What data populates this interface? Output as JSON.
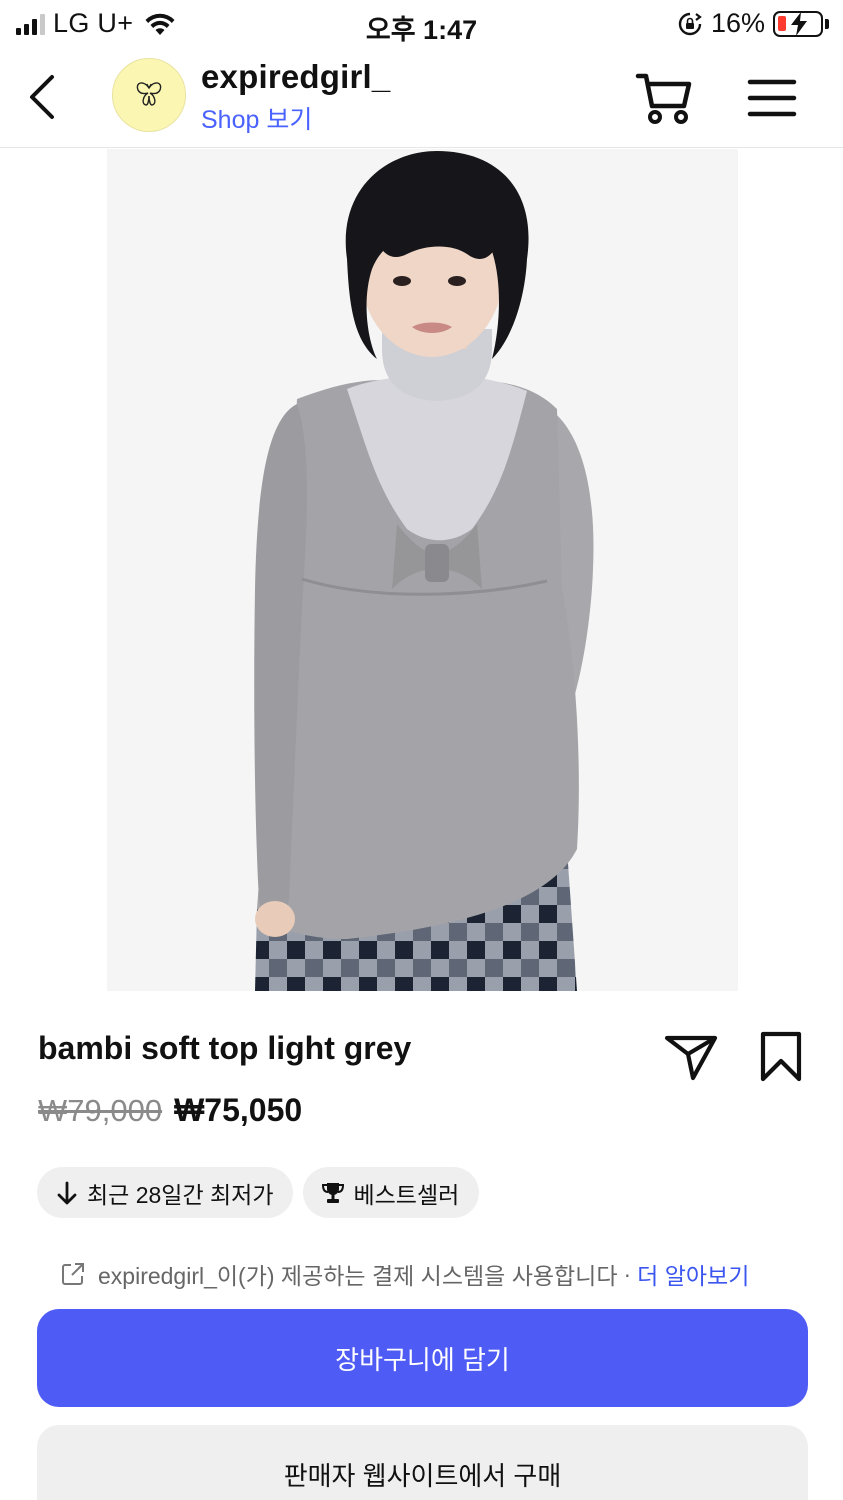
{
  "status_bar": {
    "carrier": "LG U+",
    "time": "오후 1:47",
    "battery_percent": "16%",
    "battery_level": 0.16,
    "icons": [
      "signal-icon",
      "wifi-icon",
      "rotation-lock-icon",
      "battery-charging-icon"
    ]
  },
  "header": {
    "shop_name": "expiredgirl_",
    "shop_link": "Shop 보기",
    "icons": [
      "back-arrow-icon",
      "butterfly-logo-icon",
      "cart-icon",
      "hamburger-menu-icon"
    ]
  },
  "product": {
    "title": "bambi soft top light grey",
    "original_price": "₩79,000",
    "sale_price": "₩75,050",
    "badges": [
      {
        "icon": "arrow-down-icon",
        "label": "최근 28일간 최저가"
      },
      {
        "icon": "trophy-icon",
        "label": "베스트셀러"
      }
    ],
    "icons": [
      "share-icon",
      "bookmark-icon"
    ]
  },
  "disclaimer": {
    "text": "expiredgirl_이(가) 제공하는 결제 시스템을 사용합니다",
    "separator": "·",
    "learn_more": "더 알아보기",
    "icon": "external-link-icon"
  },
  "actions": {
    "add_to_cart": "장바구니에 담기",
    "buy_on_seller_site": "판매자 웹사이트에서 구매"
  },
  "colors": {
    "primary_button": "#4f5bf5",
    "link": "#4a63ff",
    "avatar_bg": "#fbf7b3",
    "battery_low": "#ff3b30"
  }
}
